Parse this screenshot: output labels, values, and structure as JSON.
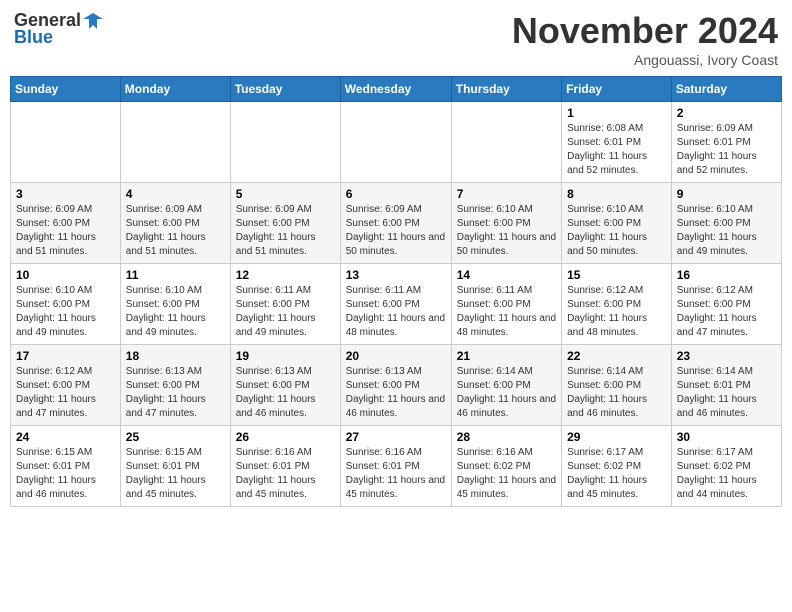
{
  "header": {
    "logo_general": "General",
    "logo_blue": "Blue",
    "month_title": "November 2024",
    "location": "Angouassi, Ivory Coast"
  },
  "weekdays": [
    "Sunday",
    "Monday",
    "Tuesday",
    "Wednesday",
    "Thursday",
    "Friday",
    "Saturday"
  ],
  "weeks": [
    [
      {
        "day": "",
        "info": ""
      },
      {
        "day": "",
        "info": ""
      },
      {
        "day": "",
        "info": ""
      },
      {
        "day": "",
        "info": ""
      },
      {
        "day": "",
        "info": ""
      },
      {
        "day": "1",
        "info": "Sunrise: 6:08 AM\nSunset: 6:01 PM\nDaylight: 11 hours and 52 minutes."
      },
      {
        "day": "2",
        "info": "Sunrise: 6:09 AM\nSunset: 6:01 PM\nDaylight: 11 hours and 52 minutes."
      }
    ],
    [
      {
        "day": "3",
        "info": "Sunrise: 6:09 AM\nSunset: 6:00 PM\nDaylight: 11 hours and 51 minutes."
      },
      {
        "day": "4",
        "info": "Sunrise: 6:09 AM\nSunset: 6:00 PM\nDaylight: 11 hours and 51 minutes."
      },
      {
        "day": "5",
        "info": "Sunrise: 6:09 AM\nSunset: 6:00 PM\nDaylight: 11 hours and 51 minutes."
      },
      {
        "day": "6",
        "info": "Sunrise: 6:09 AM\nSunset: 6:00 PM\nDaylight: 11 hours and 50 minutes."
      },
      {
        "day": "7",
        "info": "Sunrise: 6:10 AM\nSunset: 6:00 PM\nDaylight: 11 hours and 50 minutes."
      },
      {
        "day": "8",
        "info": "Sunrise: 6:10 AM\nSunset: 6:00 PM\nDaylight: 11 hours and 50 minutes."
      },
      {
        "day": "9",
        "info": "Sunrise: 6:10 AM\nSunset: 6:00 PM\nDaylight: 11 hours and 49 minutes."
      }
    ],
    [
      {
        "day": "10",
        "info": "Sunrise: 6:10 AM\nSunset: 6:00 PM\nDaylight: 11 hours and 49 minutes."
      },
      {
        "day": "11",
        "info": "Sunrise: 6:10 AM\nSunset: 6:00 PM\nDaylight: 11 hours and 49 minutes."
      },
      {
        "day": "12",
        "info": "Sunrise: 6:11 AM\nSunset: 6:00 PM\nDaylight: 11 hours and 49 minutes."
      },
      {
        "day": "13",
        "info": "Sunrise: 6:11 AM\nSunset: 6:00 PM\nDaylight: 11 hours and 48 minutes."
      },
      {
        "day": "14",
        "info": "Sunrise: 6:11 AM\nSunset: 6:00 PM\nDaylight: 11 hours and 48 minutes."
      },
      {
        "day": "15",
        "info": "Sunrise: 6:12 AM\nSunset: 6:00 PM\nDaylight: 11 hours and 48 minutes."
      },
      {
        "day": "16",
        "info": "Sunrise: 6:12 AM\nSunset: 6:00 PM\nDaylight: 11 hours and 47 minutes."
      }
    ],
    [
      {
        "day": "17",
        "info": "Sunrise: 6:12 AM\nSunset: 6:00 PM\nDaylight: 11 hours and 47 minutes."
      },
      {
        "day": "18",
        "info": "Sunrise: 6:13 AM\nSunset: 6:00 PM\nDaylight: 11 hours and 47 minutes."
      },
      {
        "day": "19",
        "info": "Sunrise: 6:13 AM\nSunset: 6:00 PM\nDaylight: 11 hours and 46 minutes."
      },
      {
        "day": "20",
        "info": "Sunrise: 6:13 AM\nSunset: 6:00 PM\nDaylight: 11 hours and 46 minutes."
      },
      {
        "day": "21",
        "info": "Sunrise: 6:14 AM\nSunset: 6:00 PM\nDaylight: 11 hours and 46 minutes."
      },
      {
        "day": "22",
        "info": "Sunrise: 6:14 AM\nSunset: 6:00 PM\nDaylight: 11 hours and 46 minutes."
      },
      {
        "day": "23",
        "info": "Sunrise: 6:14 AM\nSunset: 6:01 PM\nDaylight: 11 hours and 46 minutes."
      }
    ],
    [
      {
        "day": "24",
        "info": "Sunrise: 6:15 AM\nSunset: 6:01 PM\nDaylight: 11 hours and 46 minutes."
      },
      {
        "day": "25",
        "info": "Sunrise: 6:15 AM\nSunset: 6:01 PM\nDaylight: 11 hours and 45 minutes."
      },
      {
        "day": "26",
        "info": "Sunrise: 6:16 AM\nSunset: 6:01 PM\nDaylight: 11 hours and 45 minutes."
      },
      {
        "day": "27",
        "info": "Sunrise: 6:16 AM\nSunset: 6:01 PM\nDaylight: 11 hours and 45 minutes."
      },
      {
        "day": "28",
        "info": "Sunrise: 6:16 AM\nSunset: 6:02 PM\nDaylight: 11 hours and 45 minutes."
      },
      {
        "day": "29",
        "info": "Sunrise: 6:17 AM\nSunset: 6:02 PM\nDaylight: 11 hours and 45 minutes."
      },
      {
        "day": "30",
        "info": "Sunrise: 6:17 AM\nSunset: 6:02 PM\nDaylight: 11 hours and 44 minutes."
      }
    ]
  ]
}
